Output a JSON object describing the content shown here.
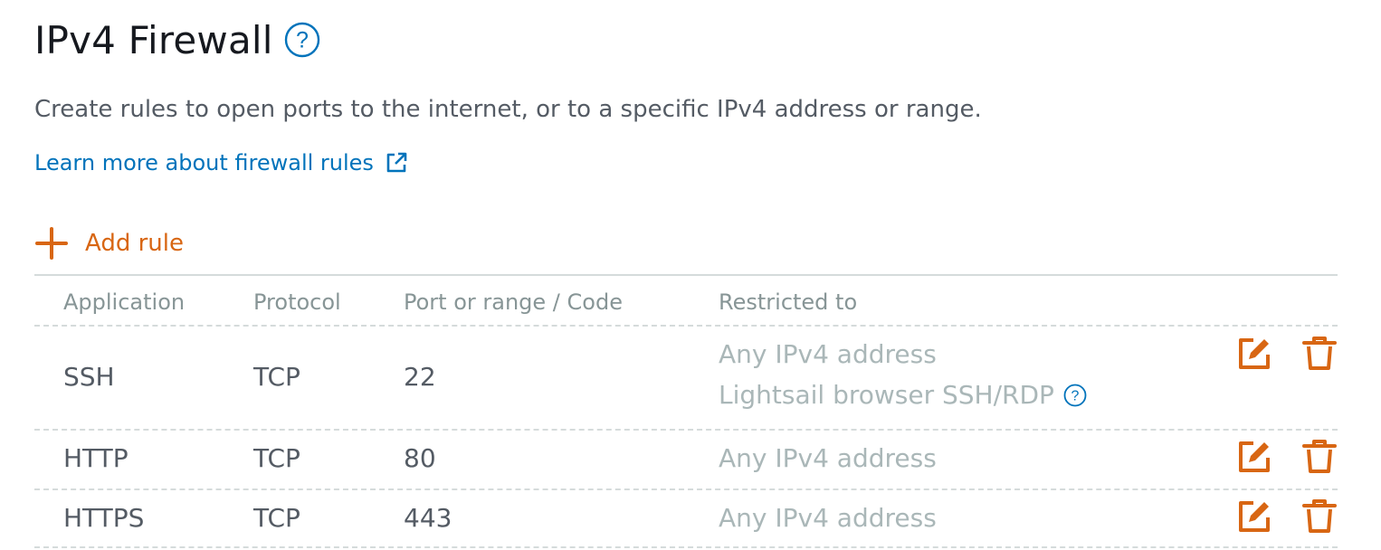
{
  "header": {
    "title": "IPv4 Firewall",
    "help_icon": "help-circle-icon"
  },
  "description": "Create rules to open ports to the internet, or to a specific IPv4 address or range.",
  "learn_more": {
    "label": "Learn more about firewall rules",
    "icon": "external-link-icon"
  },
  "add_rule": {
    "label": "Add rule",
    "icon": "plus-icon"
  },
  "table": {
    "columns": [
      "Application",
      "Protocol",
      "Port or range / Code",
      "Restricted to"
    ],
    "rows": [
      {
        "application": "SSH",
        "protocol": "TCP",
        "port": "22",
        "restricted": [
          "Any IPv4 address",
          "Lightsail browser SSH/RDP"
        ]
      },
      {
        "application": "HTTP",
        "protocol": "TCP",
        "port": "80",
        "restricted": [
          "Any IPv4 address"
        ]
      },
      {
        "application": "HTTPS",
        "protocol": "TCP",
        "port": "443",
        "restricted": [
          "Any IPv4 address"
        ]
      }
    ]
  },
  "colors": {
    "accent_orange": "#d86613",
    "link_blue": "#0073bb",
    "title_text": "#16191f",
    "body_text": "#545b64",
    "muted_text": "#aab7b8"
  }
}
